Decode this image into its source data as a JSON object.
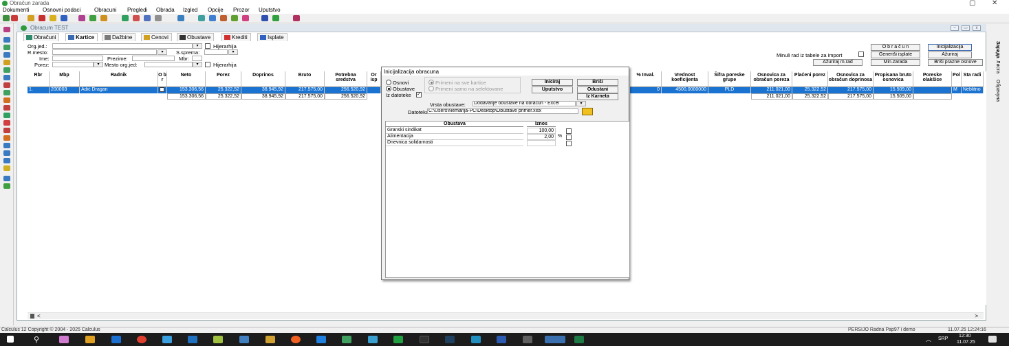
{
  "window": {
    "title": "Obračun zarada"
  },
  "menu": [
    "Dokumenti",
    "Osnovni podaci",
    "Obracuni",
    "Pregledi",
    "Obrada",
    "Izgled",
    "Opcije",
    "Prozor",
    "Uputstvo"
  ],
  "mdi": {
    "title": "Obracum TEST"
  },
  "tabs": [
    "Obračuni",
    "Kartice",
    "Dažbine",
    "Cenovi",
    "Obustave",
    "Krediti",
    "Isplate"
  ],
  "form": {
    "org_jed": "Org.jed.:",
    "hijerarhija": "Hijerarhija",
    "r_mesto": "R.mesto:",
    "s_sprema": "S.sprema:",
    "ime": "Ime:",
    "prezime": "Prezime:",
    "mbr": "Mbr:",
    "porez": "Porez:",
    "mesto_org_jed": "Mesto org.jed:",
    "hijerarhija2": "Hijerarhija"
  },
  "right_buttons": {
    "obracun": "O b r a č u n",
    "inicijalizacija": "Inicijalizacija",
    "minuli_rad": "Minuli rad iz tabele za import",
    "generisi_isplate": "Generiši isplate",
    "azuriraj": "Ažuriraj",
    "azuriraj_mrad": "Ažuriraj m.rad",
    "min_zarada": "Min.zarada",
    "brisi_prazne": "Briši prazne osnove"
  },
  "side_labels": [
    "Зарада",
    "Листа",
    "Обрачуна"
  ],
  "grid": {
    "left_headers": [
      "Rbr",
      "Mbp",
      "Radnik",
      "O b r",
      "Neto",
      "Porez",
      "Doprinos",
      "Bruto",
      "Potrebna sredstva",
      "Or isp"
    ],
    "right_headers": [
      "% Inval.",
      "Vrednost koeficijenta",
      "Šifra poreske grupe",
      "Osnovica za obračun poreza",
      "Plaćeni porez",
      "Osnovica za obračun doprinosa",
      "Propisana bruto osnovica",
      "Poreske olakšice",
      "Pol",
      "Sta radi"
    ],
    "row": {
      "rbr": "1.",
      "mbp": "200003",
      "radnik": "Adić Dragan",
      "neto": "153.306,56",
      "porez": "25.322,52",
      "doprinos": "38.945,92",
      "bruto": "217.575,00",
      "potrebna": "256.520,92",
      "inval": "0",
      "koef": "4500,0000000",
      "sifra": "PLD",
      "osn_porez": "211.021,00",
      "placeni": "25.322,52",
      "osn_doprinos": "217.575,00",
      "propisana": "15.509,00",
      "olaksice": "",
      "pol": "M",
      "sta": "Neblitno"
    },
    "totals": {
      "neto": "153.306,56",
      "porez": "25.322,52",
      "doprinos": "38.945,92",
      "bruto": "217.575,00",
      "potrebna": "256.520,92",
      "osn_porez": "211.021,00",
      "placeni": "25.322,52",
      "osn_doprinos": "217.575,00",
      "propisana": "15.509,00"
    }
  },
  "dialog": {
    "title": "Inicijalizacija obracuna",
    "radio_osnovi": "Osnovi",
    "radio_obustave": "Obustave",
    "iz_datoteke": "Iz datoteke",
    "primeni_sve": "Primeni na sve kartice",
    "primeni_sel": "Primeni samo na selektovane",
    "iniciraj": "Iniciraj",
    "brisi": "Briši",
    "uputstvo": "Uputstvo",
    "odustani": "Odustani",
    "iz_karneta": "Iz Karneta",
    "vrsta_label": "Vrsta obustave:",
    "vrsta_value": "Dodavanje obustave na obračun - Excel",
    "datoteka_label": "Datoteka:",
    "datoteka_value": "C:\\Users\\Nemanja-PC\\Desktop\\Obustave primer.xlsx",
    "col_obustava": "Obustava",
    "col_iznos": "Iznos",
    "rows": [
      {
        "name": "Granski sindikat",
        "iznos": "100,00",
        "unit": ""
      },
      {
        "name": "Alimentacija",
        "iznos": "2,00",
        "unit": "%"
      },
      {
        "name": "Dnevnica solidarnosti",
        "iznos": "",
        "unit": ""
      }
    ]
  },
  "status": {
    "left": "Calculus 12  Copyright © 2004 - 2025  Calculus",
    "mid": "PERSIJO Radna Pap97 i demo",
    "right": "11.07.25 12:24:16"
  },
  "taskbar": {
    "lang": "SRP",
    "time": "12:30",
    "date": "11.07.25"
  }
}
